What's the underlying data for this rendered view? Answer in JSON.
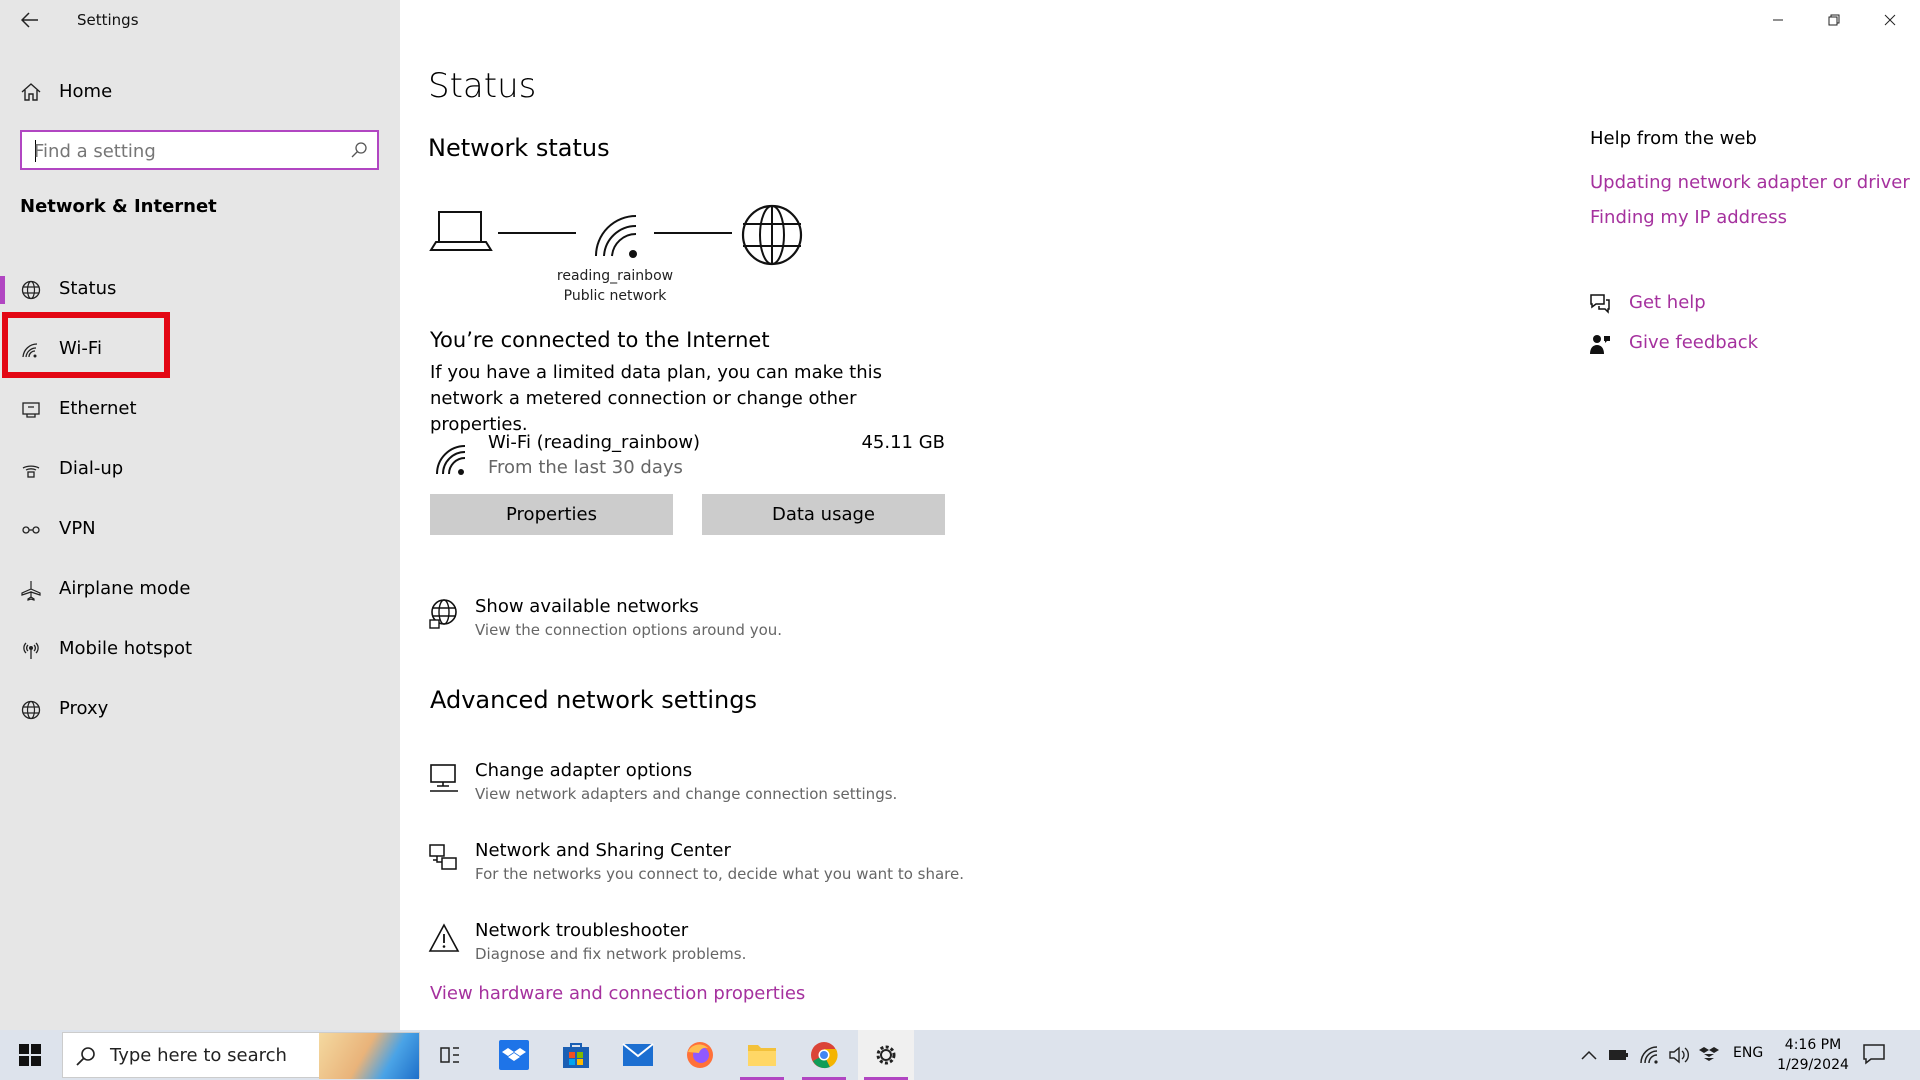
{
  "window": {
    "title": "Settings",
    "controls": {
      "minimize": "minimize",
      "restore": "restore",
      "close": "close"
    }
  },
  "sidebar": {
    "home_label": "Home",
    "search": {
      "placeholder": "Find a setting",
      "value": ""
    },
    "section_header": "Network & Internet",
    "items": [
      {
        "label": "Status",
        "icon": "globe-icon"
      },
      {
        "label": "Wi-Fi",
        "icon": "wifi-icon"
      },
      {
        "label": "Ethernet",
        "icon": "ethernet-icon"
      },
      {
        "label": "Dial-up",
        "icon": "dialup-icon"
      },
      {
        "label": "VPN",
        "icon": "vpn-icon"
      },
      {
        "label": "Airplane mode",
        "icon": "airplane-icon"
      },
      {
        "label": "Mobile hotspot",
        "icon": "hotspot-icon"
      },
      {
        "label": "Proxy",
        "icon": "globe-icon"
      }
    ],
    "active_index": 0,
    "highlighted_index": 1
  },
  "main": {
    "title": "Status",
    "network_status_header": "Network status",
    "network": {
      "name": "reading_rainbow",
      "type": "Public network"
    },
    "connected_header": "You’re connected to the Internet",
    "connected_desc": "If you have a limited data plan, you can make this network a metered connection or change other properties.",
    "wifi_row": {
      "name": "Wi-Fi (reading_rainbow)",
      "sub": "From the last 30 days",
      "size": "45.11 GB"
    },
    "buttons": {
      "properties": "Properties",
      "data_usage": "Data usage"
    },
    "show_networks": {
      "title": "Show available networks",
      "desc": "View the connection options around you."
    },
    "advanced_header": "Advanced network settings",
    "advanced": [
      {
        "title": "Change adapter options",
        "desc": "View network adapters and change connection settings."
      },
      {
        "title": "Network and Sharing Center",
        "desc": "For the networks you connect to, decide what you want to share."
      },
      {
        "title": "Network troubleshooter",
        "desc": "Diagnose and fix network problems."
      }
    ],
    "hardware_link": "View hardware and connection properties"
  },
  "help": {
    "header": "Help from the web",
    "links": [
      "Updating network adapter or driver",
      "Finding my IP address"
    ],
    "get_help": "Get help",
    "give_feedback": "Give feedback"
  },
  "taskbar": {
    "search_text": "Type here to search",
    "lang": "ENG",
    "time": "4:16 PM",
    "date": "1/29/2024"
  },
  "colors": {
    "accent": "#b146c2",
    "link": "#a5319e",
    "highlight": "#e30613",
    "sidebar_bg": "#e6e6e6",
    "taskbar_bg": "#dde3ec"
  }
}
